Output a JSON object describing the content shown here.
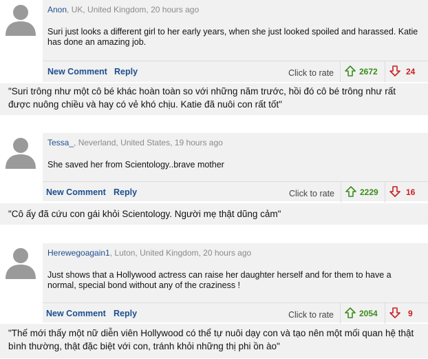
{
  "comments": [
    {
      "username": "Anon",
      "location": ", UK, United Kingdom, 20 hours ago",
      "text": "Suri just looks a different girl to her early years, when she just looked spoiled and harassed. Katie has done an amazing job.",
      "new_comment_label": "New Comment",
      "reply_label": "Reply",
      "click_to_rate": "Click to rate",
      "up_votes": "2672",
      "down_votes": "24",
      "translation": "\"Suri trông như một cô bé khác hoàn toàn so với những năm trước, hồi đó cô bé trông như rất được nuông chiều và hay có vẻ khó chịu. Katie đã nuôi con rất tốt\""
    },
    {
      "username": "Tessa_",
      "location": ", Neverland, United States, 19 hours ago",
      "text": "She saved her from Scientology..brave mother",
      "new_comment_label": "New Comment",
      "reply_label": "Reply",
      "click_to_rate": "Click to rate",
      "up_votes": "2229",
      "down_votes": "16",
      "translation": "\"Cô ấy đã cứu con gái khỏi Scientology. Người mẹ thật dũng cảm\""
    },
    {
      "username": "Herewegoagain1",
      "location": ", Luton, United Kingdom, 20 hours ago",
      "text": "Just shows that a Hollywood actress can raise her daughter herself and for them to have a normal, special bond without any of the craziness !",
      "new_comment_label": "New Comment",
      "reply_label": "Reply",
      "click_to_rate": "Click to rate",
      "up_votes": "2054",
      "down_votes": "9",
      "translation": "\"Thế mới thấy một nữ diễn viên Hollywood có thể tự nuôi dạy con và tạo nên một mối quan hệ thật bình thường, thật đặc biệt với con, tránh khỏi những thị phi ồn ào\""
    }
  ],
  "colors": {
    "link": "#1d4e8f",
    "up": "#3a8d1a",
    "down": "#c81e1e",
    "panel": "#f1f1f1"
  },
  "icons": [
    "default-avatar-icon",
    "thumbs-up-arrow-icon",
    "thumbs-down-arrow-icon"
  ]
}
